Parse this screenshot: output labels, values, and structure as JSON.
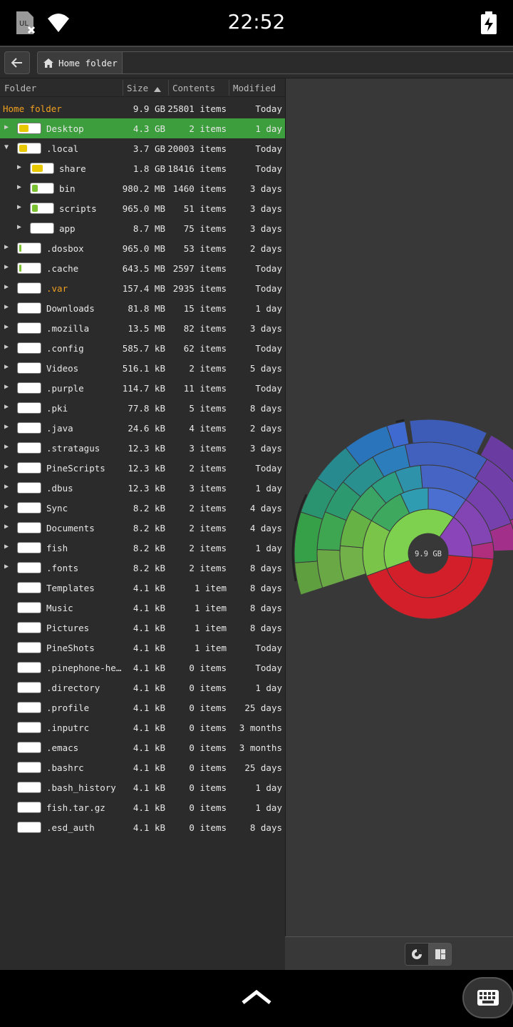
{
  "status": {
    "clock": "22:52"
  },
  "toolbar": {
    "breadcrumb_label": "Home folder"
  },
  "columns": {
    "folder": "Folder",
    "size": "Size",
    "contents": "Contents",
    "modified": "Modified"
  },
  "root": {
    "name": "Home folder",
    "size": "9.9 GB",
    "contents": "25801 items",
    "modified": "Today"
  },
  "colors": {
    "accent_orange": "#f0a020",
    "selection_green": "#3c9e3c",
    "bar_yellow": "#e8c800",
    "bar_green": "#7ac232"
  },
  "rows": [
    {
      "name": "Desktop",
      "size": "4.3 GB",
      "contents": "2 items",
      "modified": "1 day",
      "depth": 0,
      "expander": "collapsed",
      "fill": 0.43,
      "fill_color": "#e8c800",
      "selected": true
    },
    {
      "name": ".local",
      "size": "3.7 GB",
      "contents": "20003 items",
      "modified": "Today",
      "depth": 0,
      "expander": "expanded",
      "fill": 0.37,
      "fill_color": "#e8c800"
    },
    {
      "name": "share",
      "size": "1.8 GB",
      "contents": "18416 items",
      "modified": "Today",
      "depth": 1,
      "expander": "collapsed",
      "fill": 0.49,
      "fill_color": "#e8c800"
    },
    {
      "name": "bin",
      "size": "980.2 MB",
      "contents": "1460 items",
      "modified": "3 days",
      "depth": 1,
      "expander": "collapsed",
      "fill": 0.26,
      "fill_color": "#7ac232"
    },
    {
      "name": "scripts",
      "size": "965.0 MB",
      "contents": "51 items",
      "modified": "3 days",
      "depth": 1,
      "expander": "collapsed",
      "fill": 0.26,
      "fill_color": "#7ac232"
    },
    {
      "name": "app",
      "size": "8.7 MB",
      "contents": "75 items",
      "modified": "3 days",
      "depth": 1,
      "expander": "collapsed",
      "fill": 0.0,
      "fill_color": "#7ac232"
    },
    {
      "name": ".dosbox",
      "size": "965.0 MB",
      "contents": "53 items",
      "modified": "2 days",
      "depth": 0,
      "expander": "collapsed",
      "fill": 0.1,
      "fill_color": "#7ac232"
    },
    {
      "name": ".cache",
      "size": "643.5 MB",
      "contents": "2597 items",
      "modified": "Today",
      "depth": 0,
      "expander": "collapsed",
      "fill": 0.07,
      "fill_color": "#7ac232"
    },
    {
      "name": ".var",
      "size": "157.4 MB",
      "contents": "2935 items",
      "modified": "Today",
      "depth": 0,
      "expander": "collapsed",
      "fill": 0.0,
      "fill_color": "#7ac232",
      "highlight": true
    },
    {
      "name": "Downloads",
      "size": "81.8 MB",
      "contents": "15 items",
      "modified": "1 day",
      "depth": 0,
      "expander": "collapsed",
      "fill": 0.0,
      "fill_color": "#7ac232"
    },
    {
      "name": ".mozilla",
      "size": "13.5 MB",
      "contents": "82 items",
      "modified": "3 days",
      "depth": 0,
      "expander": "collapsed",
      "fill": 0.0,
      "fill_color": "#7ac232"
    },
    {
      "name": ".config",
      "size": "585.7 kB",
      "contents": "62 items",
      "modified": "Today",
      "depth": 0,
      "expander": "collapsed",
      "fill": 0.0,
      "fill_color": "#7ac232"
    },
    {
      "name": "Videos",
      "size": "516.1 kB",
      "contents": "2 items",
      "modified": "5 days",
      "depth": 0,
      "expander": "collapsed",
      "fill": 0.0,
      "fill_color": "#7ac232"
    },
    {
      "name": ".purple",
      "size": "114.7 kB",
      "contents": "11 items",
      "modified": "Today",
      "depth": 0,
      "expander": "collapsed",
      "fill": 0.0,
      "fill_color": "#7ac232"
    },
    {
      "name": ".pki",
      "size": "77.8 kB",
      "contents": "5 items",
      "modified": "8 days",
      "depth": 0,
      "expander": "collapsed",
      "fill": 0.0,
      "fill_color": "#7ac232"
    },
    {
      "name": ".java",
      "size": "24.6 kB",
      "contents": "4 items",
      "modified": "2 days",
      "depth": 0,
      "expander": "collapsed",
      "fill": 0.0,
      "fill_color": "#7ac232"
    },
    {
      "name": ".stratagus",
      "size": "12.3 kB",
      "contents": "3 items",
      "modified": "3 days",
      "depth": 0,
      "expander": "collapsed",
      "fill": 0.0,
      "fill_color": "#7ac232"
    },
    {
      "name": "PineScripts",
      "size": "12.3 kB",
      "contents": "2 items",
      "modified": "Today",
      "depth": 0,
      "expander": "collapsed",
      "fill": 0.0,
      "fill_color": "#7ac232"
    },
    {
      "name": ".dbus",
      "size": "12.3 kB",
      "contents": "3 items",
      "modified": "1 day",
      "depth": 0,
      "expander": "collapsed",
      "fill": 0.0,
      "fill_color": "#7ac232"
    },
    {
      "name": "Sync",
      "size": "8.2 kB",
      "contents": "2 items",
      "modified": "4 days",
      "depth": 0,
      "expander": "collapsed",
      "fill": 0.0,
      "fill_color": "#7ac232"
    },
    {
      "name": "Documents",
      "size": "8.2 kB",
      "contents": "2 items",
      "modified": "4 days",
      "depth": 0,
      "expander": "collapsed",
      "fill": 0.0,
      "fill_color": "#7ac232"
    },
    {
      "name": "fish",
      "size": "8.2 kB",
      "contents": "2 items",
      "modified": "1 day",
      "depth": 0,
      "expander": "collapsed",
      "fill": 0.0,
      "fill_color": "#7ac232"
    },
    {
      "name": ".fonts",
      "size": "8.2 kB",
      "contents": "2 items",
      "modified": "8 days",
      "depth": 0,
      "expander": "collapsed",
      "fill": 0.0,
      "fill_color": "#7ac232"
    },
    {
      "name": "Templates",
      "size": "4.1 kB",
      "contents": "1 item",
      "modified": "8 days",
      "depth": 0,
      "expander": "none",
      "fill": 0.0,
      "fill_color": "#7ac232"
    },
    {
      "name": "Music",
      "size": "4.1 kB",
      "contents": "1 item",
      "modified": "8 days",
      "depth": 0,
      "expander": "none",
      "fill": 0.0,
      "fill_color": "#7ac232"
    },
    {
      "name": "Pictures",
      "size": "4.1 kB",
      "contents": "1 item",
      "modified": "8 days",
      "depth": 0,
      "expander": "none",
      "fill": 0.0,
      "fill_color": "#7ac232"
    },
    {
      "name": "PineShots",
      "size": "4.1 kB",
      "contents": "1 item",
      "modified": "Today",
      "depth": 0,
      "expander": "none",
      "fill": 0.0,
      "fill_color": "#7ac232"
    },
    {
      "name": ".pinephone-he…",
      "size": "4.1 kB",
      "contents": "0 items",
      "modified": "Today",
      "depth": 0,
      "expander": "none",
      "fill": 0.0,
      "fill_color": "#7ac232"
    },
    {
      "name": ".directory",
      "size": "4.1 kB",
      "contents": "0 items",
      "modified": "1 day",
      "depth": 0,
      "expander": "none",
      "fill": 0.0,
      "fill_color": "#7ac232"
    },
    {
      "name": ".profile",
      "size": "4.1 kB",
      "contents": "0 items",
      "modified": "25 days",
      "depth": 0,
      "expander": "none",
      "fill": 0.0,
      "fill_color": "#7ac232"
    },
    {
      "name": ".inputrc",
      "size": "4.1 kB",
      "contents": "0 items",
      "modified": "3 months",
      "depth": 0,
      "expander": "none",
      "fill": 0.0,
      "fill_color": "#7ac232"
    },
    {
      "name": ".emacs",
      "size": "4.1 kB",
      "contents": "0 items",
      "modified": "3 months",
      "depth": 0,
      "expander": "none",
      "fill": 0.0,
      "fill_color": "#7ac232"
    },
    {
      "name": ".bashrc",
      "size": "4.1 kB",
      "contents": "0 items",
      "modified": "25 days",
      "depth": 0,
      "expander": "none",
      "fill": 0.0,
      "fill_color": "#7ac232"
    },
    {
      "name": ".bash_history",
      "size": "4.1 kB",
      "contents": "0 items",
      "modified": "1 day",
      "depth": 0,
      "expander": "none",
      "fill": 0.0,
      "fill_color": "#7ac232"
    },
    {
      "name": "fish.tar.gz",
      "size": "4.1 kB",
      "contents": "0 items",
      "modified": "1 day",
      "depth": 0,
      "expander": "none",
      "fill": 0.0,
      "fill_color": "#7ac232"
    },
    {
      "name": ".esd_auth",
      "size": "4.1 kB",
      "contents": "0 items",
      "modified": "8 days",
      "depth": 0,
      "expander": "none",
      "fill": 0.0,
      "fill_color": "#7ac232"
    }
  ],
  "ring_chart": {
    "center_label": "9.9 GB"
  },
  "view_buttons": {
    "ring": "ring-chart-icon",
    "treemap": "treemap-icon"
  },
  "icons": {
    "sim": "sim-card-missing-icon",
    "wifi": "wifi-icon",
    "battery": "battery-charging-icon",
    "back": "back-arrow-icon",
    "home": "home-icon",
    "sort": "sort-ascending-icon",
    "nav_up": "chevron-up-icon",
    "keyboard": "keyboard-icon"
  }
}
